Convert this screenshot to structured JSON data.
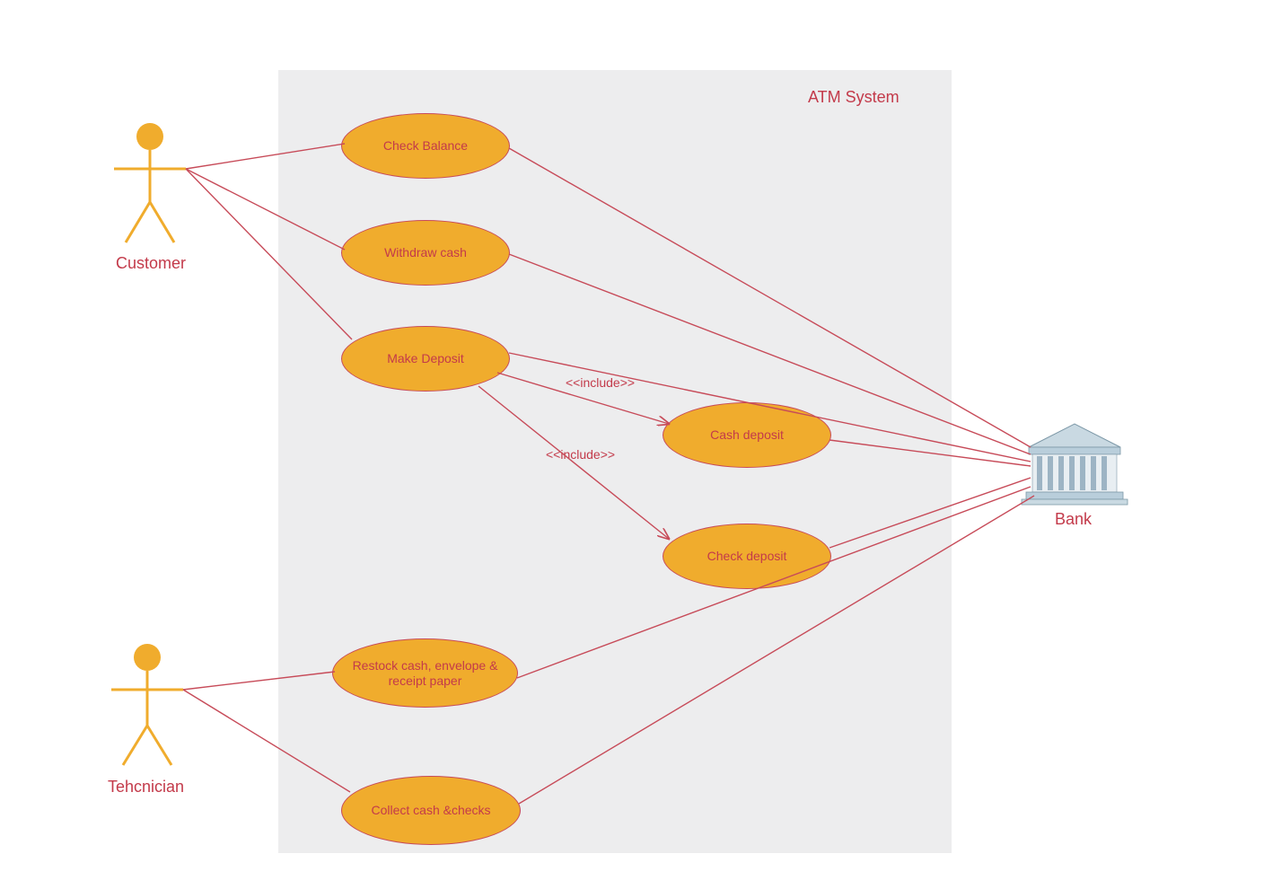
{
  "system": {
    "title": "ATM System"
  },
  "actors": {
    "customer": {
      "label": "Customer"
    },
    "technician": {
      "label": "Tehcnician"
    },
    "bank": {
      "label": "Bank"
    }
  },
  "usecases": {
    "check_balance": "Check Balance",
    "withdraw_cash": "Withdraw cash",
    "make_deposit": "Make Deposit",
    "cash_deposit": "Cash deposit",
    "check_deposit": "Check deposit",
    "restock": "Restock cash, envelope & receipt paper",
    "collect": "Collect cash &checks"
  },
  "relations": {
    "include1": "<<include>>",
    "include2": "<<include>>"
  },
  "colors": {
    "line": "#c74b59",
    "usecase_fill": "#f0ac2d",
    "actor_fill": "#f0ac2d",
    "text": "#c33a4a",
    "box": "#ededee"
  }
}
